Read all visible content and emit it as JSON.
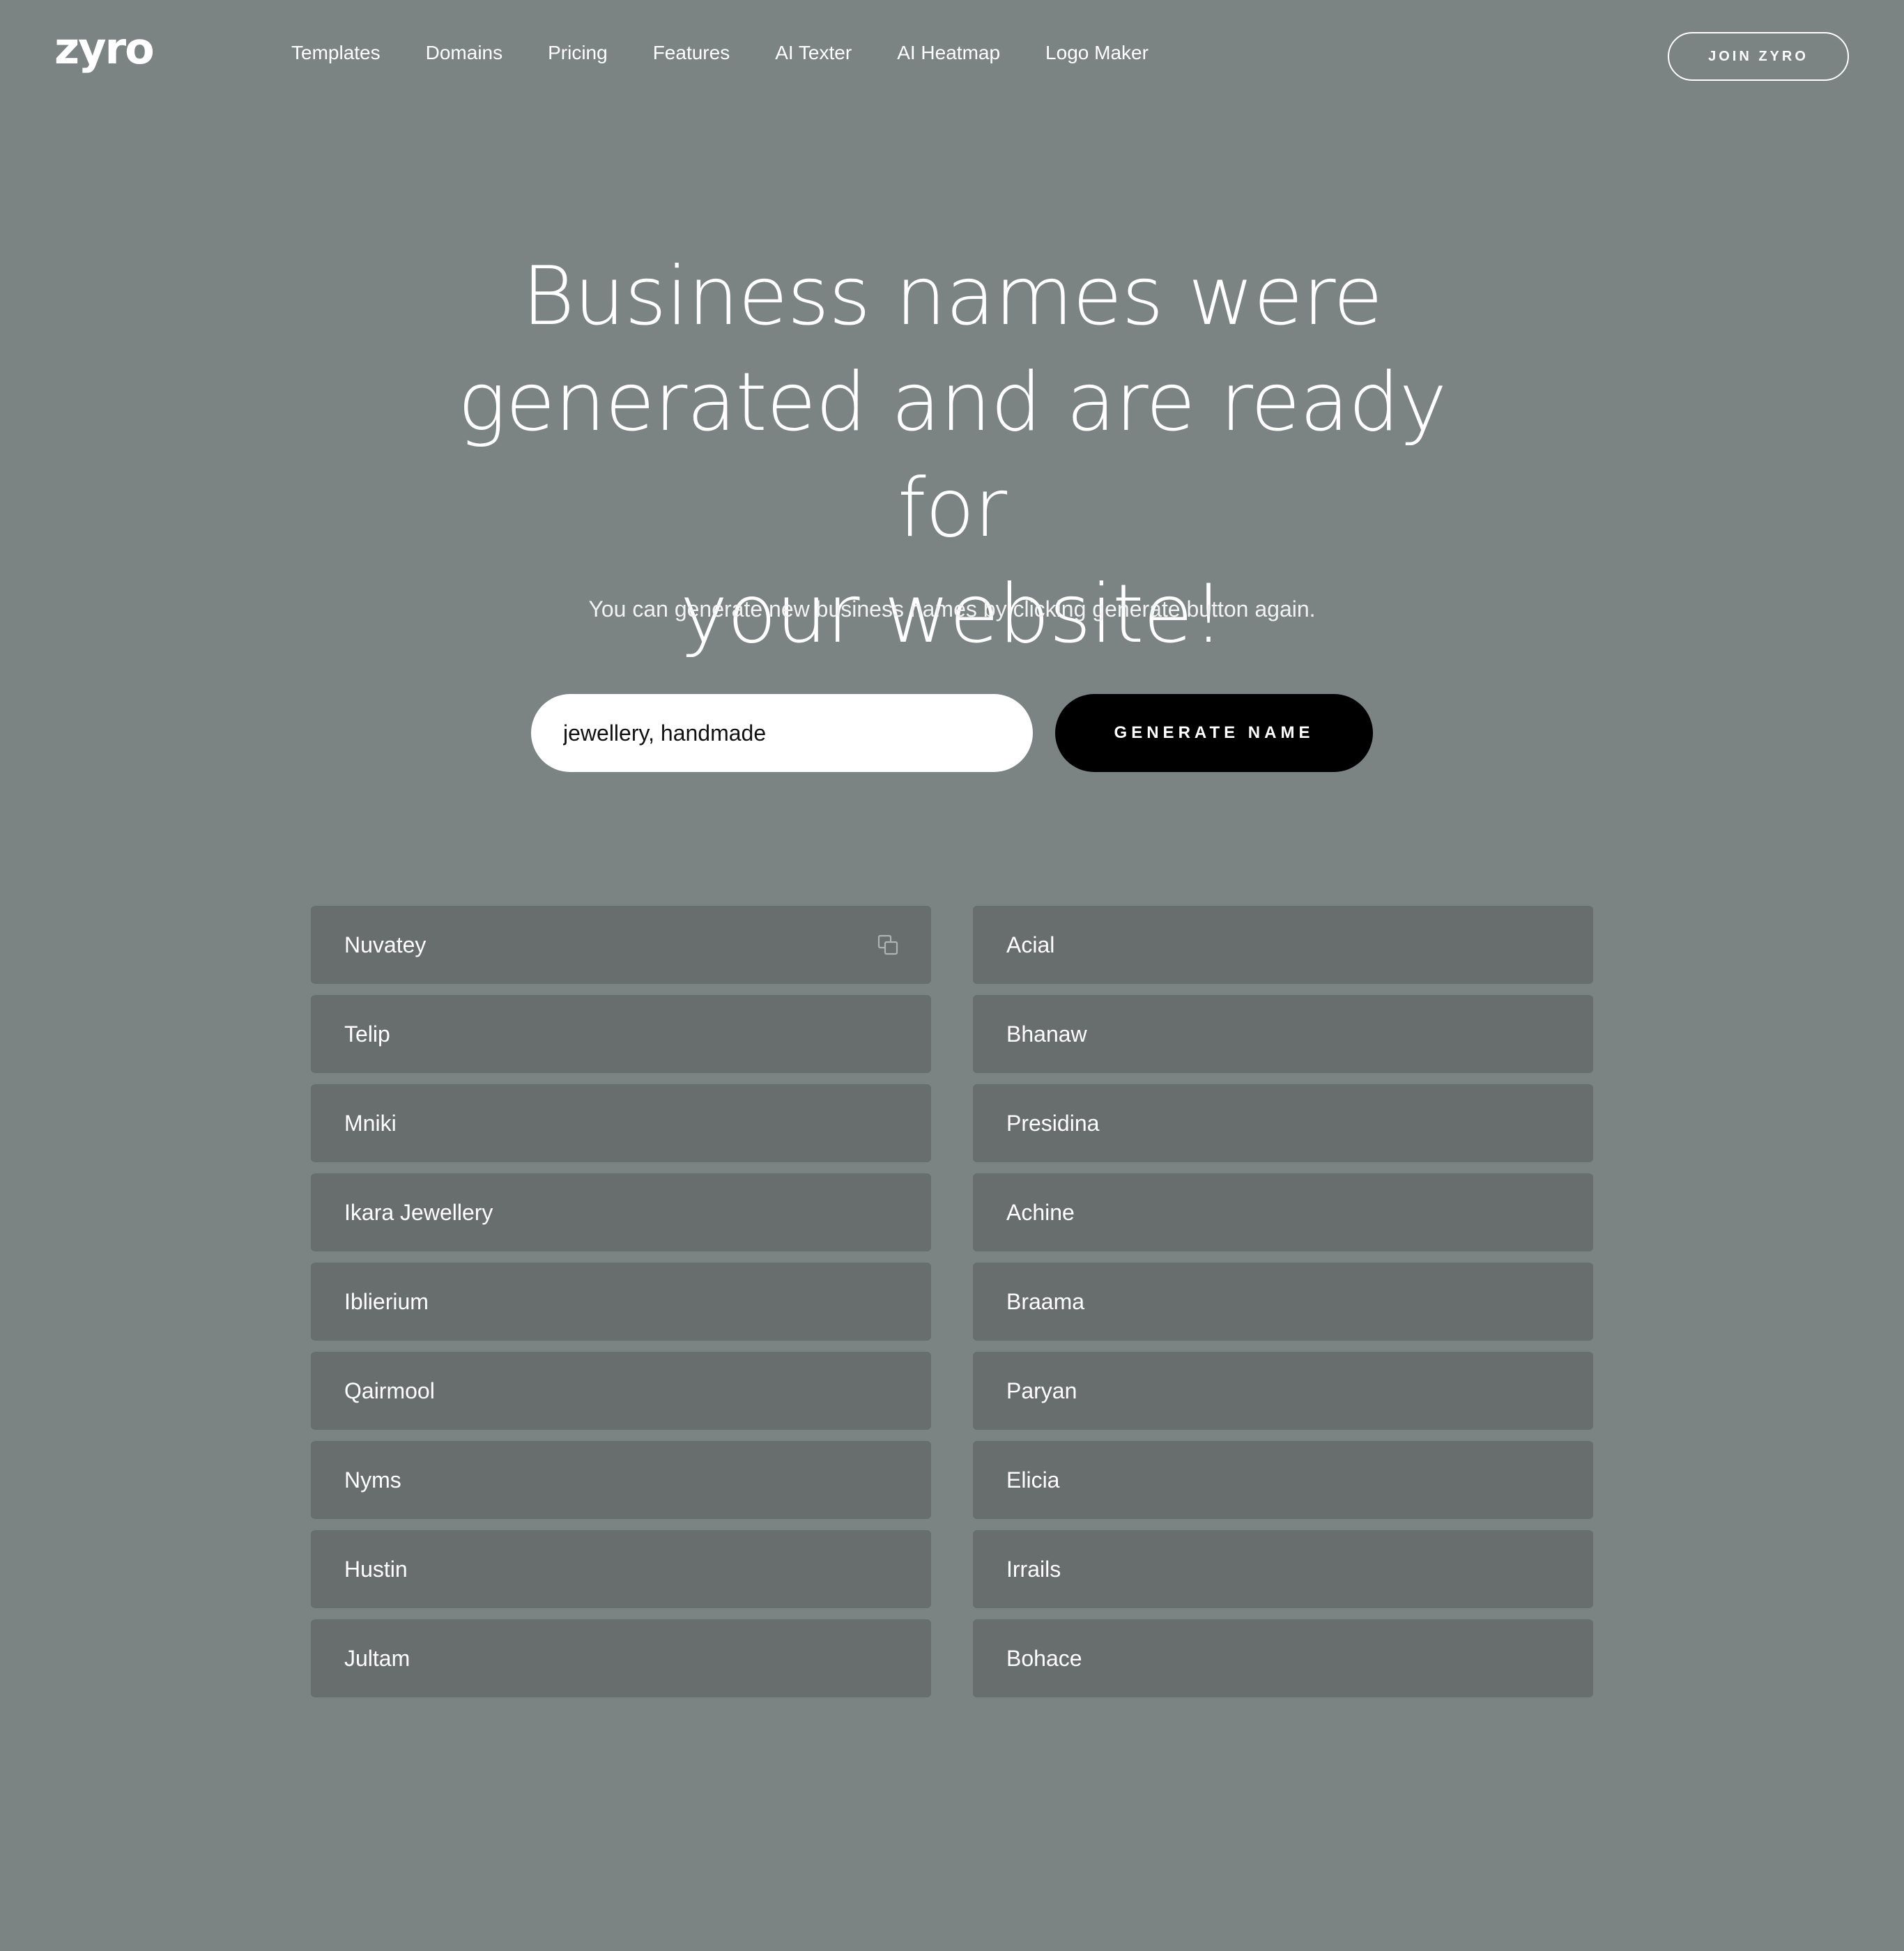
{
  "header": {
    "logo": "zyro",
    "nav": [
      {
        "label": "Templates"
      },
      {
        "label": "Domains"
      },
      {
        "label": "Pricing"
      },
      {
        "label": "Features"
      },
      {
        "label": "AI Texter"
      },
      {
        "label": "AI Heatmap"
      },
      {
        "label": "Logo Maker"
      }
    ],
    "join_label": "JOIN ZYRO"
  },
  "hero": {
    "title_line1": "Business names were",
    "title_line2": "generated and are ready for",
    "title_line3": "your website!",
    "subtitle": "You can generate new business names by clicking generate button again."
  },
  "search": {
    "value": "jewellery, handmade",
    "button_label": "GENERATE NAME"
  },
  "results": {
    "left": [
      "Nuvatey",
      "Telip",
      "Mniki",
      "Ikara Jewellery",
      "Iblierium",
      "Qairmool",
      "Nyms",
      "Hustin",
      "Jultam"
    ],
    "right": [
      "Acial",
      "Bhanaw",
      "Presidina",
      "Achine",
      "Braama",
      "Paryan",
      "Elicia",
      "Irrails",
      "Bohace"
    ],
    "copy_icon": "copy-icon"
  },
  "colors": {
    "background": "#7b8482",
    "card": "#686e6d",
    "button": "#000000",
    "text": "#ffffff"
  }
}
